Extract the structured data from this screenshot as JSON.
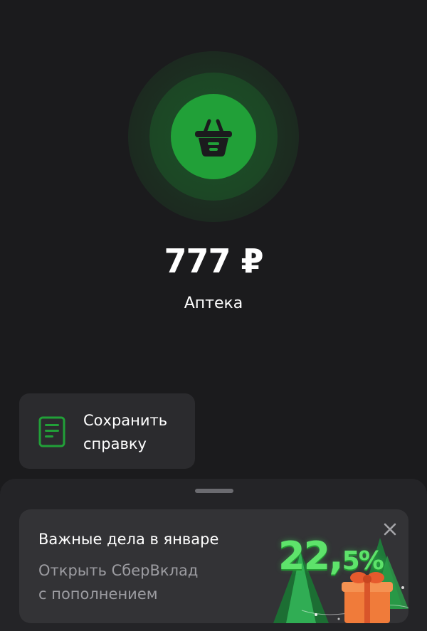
{
  "transaction": {
    "amount": "777 ₽",
    "merchant": "Аптека",
    "category_icon": "shopping-basket-icon",
    "accent_color": "#21a038"
  },
  "actions": {
    "save_receipt": {
      "label": "Сохранить\nсправку",
      "icon": "document-icon"
    }
  },
  "promo": {
    "title": "Важные дела в январе",
    "subtitle": "Открыть СберВклад\nс пополнением",
    "rate_main": "22,",
    "rate_small": "5%",
    "close_icon": "close-icon",
    "rate_color": "#5ee36b"
  }
}
